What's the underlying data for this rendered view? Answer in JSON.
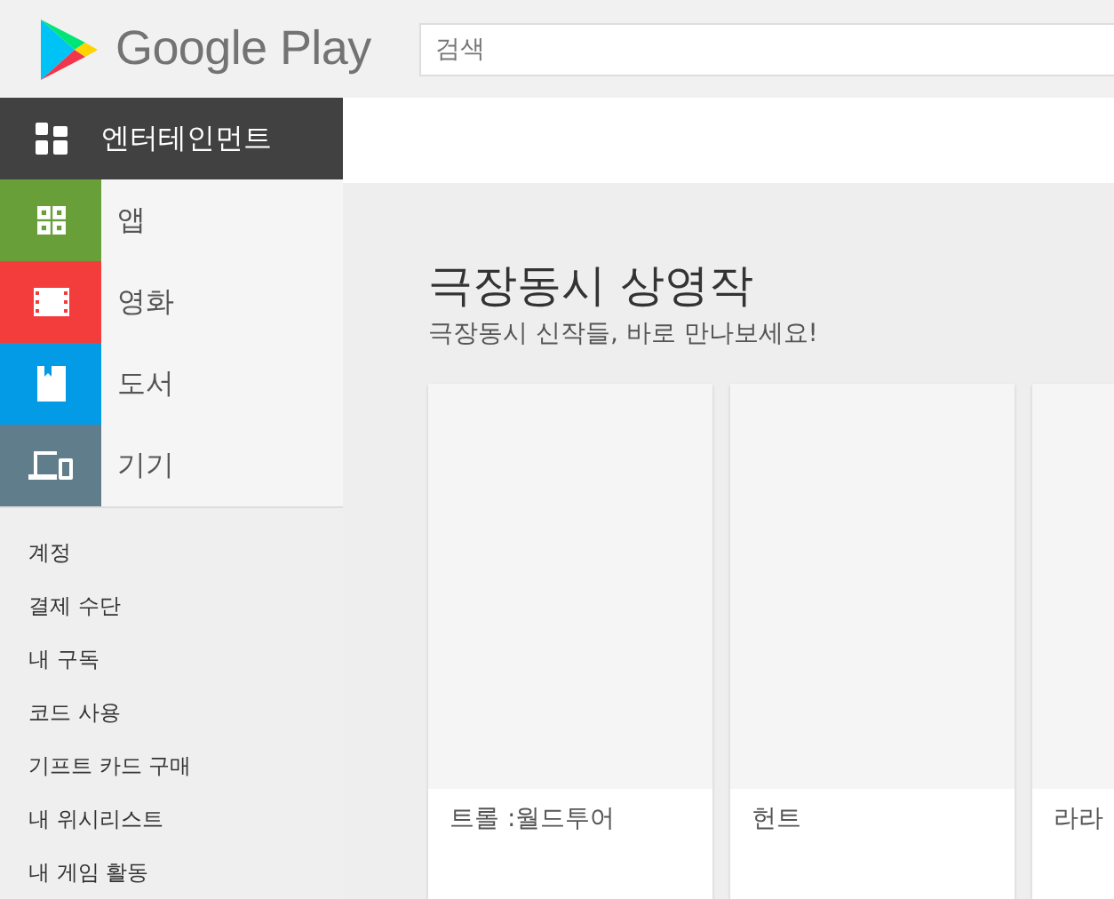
{
  "header": {
    "logo_text": "Google Play",
    "search": {
      "placeholder": "검색"
    }
  },
  "category": {
    "label": "엔터테인먼트"
  },
  "nav_items": [
    {
      "label": "앱",
      "kind": "apps",
      "color": "#689f38"
    },
    {
      "label": "영화",
      "kind": "movies",
      "color": "#f33c3c"
    },
    {
      "label": "도서",
      "kind": "books",
      "color": "#039be5"
    },
    {
      "label": "기기",
      "kind": "devices",
      "color": "#607d8b"
    }
  ],
  "account_links": [
    "계정",
    "결제 수단",
    "내 구독",
    "코드 사용",
    "기프트 카드 구매",
    "내 위시리스트",
    "내 게임 활동"
  ],
  "section": {
    "title": "극장동시 상영작",
    "subtitle": "극장동시 신작들, 바로 만나보세요!"
  },
  "cards": [
    {
      "title": "트롤 :월드투어"
    },
    {
      "title": "헌트"
    },
    {
      "title": "라라"
    }
  ]
}
